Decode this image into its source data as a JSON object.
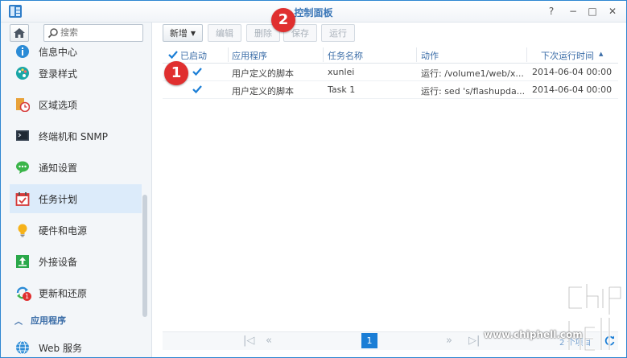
{
  "window": {
    "title": "控制面板",
    "controls": {
      "help": "?",
      "minimize": "−",
      "maximize": "□",
      "close": "✕"
    }
  },
  "sidebar": {
    "search_placeholder": "搜索",
    "items": [
      {
        "label": "信息中心",
        "icon": "info-center-icon"
      },
      {
        "label": "登录样式",
        "icon": "palette-icon"
      },
      {
        "label": "区域选项",
        "icon": "region-clock-icon"
      },
      {
        "label": "终端机和 SNMP",
        "icon": "terminal-icon"
      },
      {
        "label": "通知设置",
        "icon": "chat-bubble-icon"
      },
      {
        "label": "任务计划",
        "icon": "calendar-check-icon",
        "active": true
      },
      {
        "label": "硬件和电源",
        "icon": "lightbulb-icon"
      },
      {
        "label": "外接设备",
        "icon": "external-device-icon"
      },
      {
        "label": "更新和还原",
        "icon": "update-icon",
        "badge": "1"
      }
    ],
    "section_label": "应用程序",
    "section_items": [
      {
        "label": "Web 服务",
        "icon": "globe-icon"
      }
    ]
  },
  "toolbar": {
    "create_label": "新增",
    "edit_label": "编辑",
    "delete_label": "删除",
    "save_label": "保存",
    "run_label": "运行"
  },
  "table": {
    "headers": {
      "enabled": "已启动",
      "application": "应用程序",
      "task_name": "任务名称",
      "action": "动作",
      "next_run": "下次运行时间",
      "sort_indicator": "▲"
    },
    "rows": [
      {
        "enabled": true,
        "application": "用户定义的脚本",
        "task_name": "xunlei",
        "action": "运行: /volume1/web/x...",
        "next_run": "2014-06-04 00:00"
      },
      {
        "enabled": true,
        "application": "用户定义的脚本",
        "task_name": "Task 1",
        "action": "运行: sed 's/flashupda...",
        "next_run": "2014-06-04 00:00"
      }
    ]
  },
  "pager": {
    "current_page": "1",
    "item_count": "2 个项目"
  },
  "annotations": {
    "marker_1": "1",
    "marker_2": "2"
  },
  "watermark": {
    "url": "www.chiphell.com"
  },
  "colors": {
    "accent": "#1b7ed6",
    "title_text": "#3c78b8",
    "active_bg": "#dcebfa",
    "marker": "#e02f2f"
  }
}
